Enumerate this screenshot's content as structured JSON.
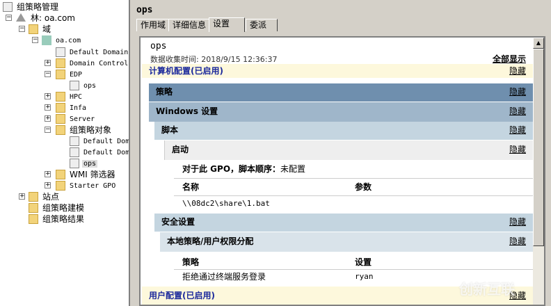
{
  "tree": {
    "root": "组策略管理",
    "forest": "林: oa.com",
    "domains": "域",
    "domain": "oa.com",
    "items": [
      "Default Domain",
      "Domain Control",
      "EDP",
      "ops",
      "HPC",
      "Infa",
      "Server",
      "组策略对象",
      "Default Dom",
      "Default Dom",
      "ops",
      "WMI 筛选器",
      "Starter GPO"
    ],
    "sites": "站点",
    "modeling": "组策略建模",
    "results": "组策略结果"
  },
  "header": {
    "title": "ops"
  },
  "tabs": [
    "作用域",
    "详细信息",
    "设置",
    "委派"
  ],
  "report": {
    "name": "ops",
    "collected": "数据收集时间: 2018/9/15 12:36:37",
    "show_all": "全部显示",
    "hide": "隐藏",
    "computer_config": "计算机配置(已启用)",
    "policies": "策略",
    "windows_settings": "Windows 设置",
    "scripts": "脚本",
    "startup": "启动",
    "script_order": "对于此 GPO，脚本顺序：",
    "script_order_value": "未配置",
    "script_cols": [
      "名称",
      "参数"
    ],
    "script_rows": [
      [
        "\\\\08dc2\\share\\1.bat",
        ""
      ]
    ],
    "security": "安全设置",
    "user_rights": "本地策略/用户权限分配",
    "rights_cols": [
      "策略",
      "设置"
    ],
    "rights_rows": [
      [
        "拒绝通过终端服务登录",
        "ryan"
      ]
    ],
    "user_config": "用户配置(已启用)"
  },
  "watermark": "创新互联",
  "colors": {
    "policies": "#6f8fae",
    "windows": "#9fb6ca",
    "scripts": "#c4d5e0",
    "startup": "#eeeeee",
    "config": "#fdf8dc",
    "link": "#1c2a9c"
  }
}
